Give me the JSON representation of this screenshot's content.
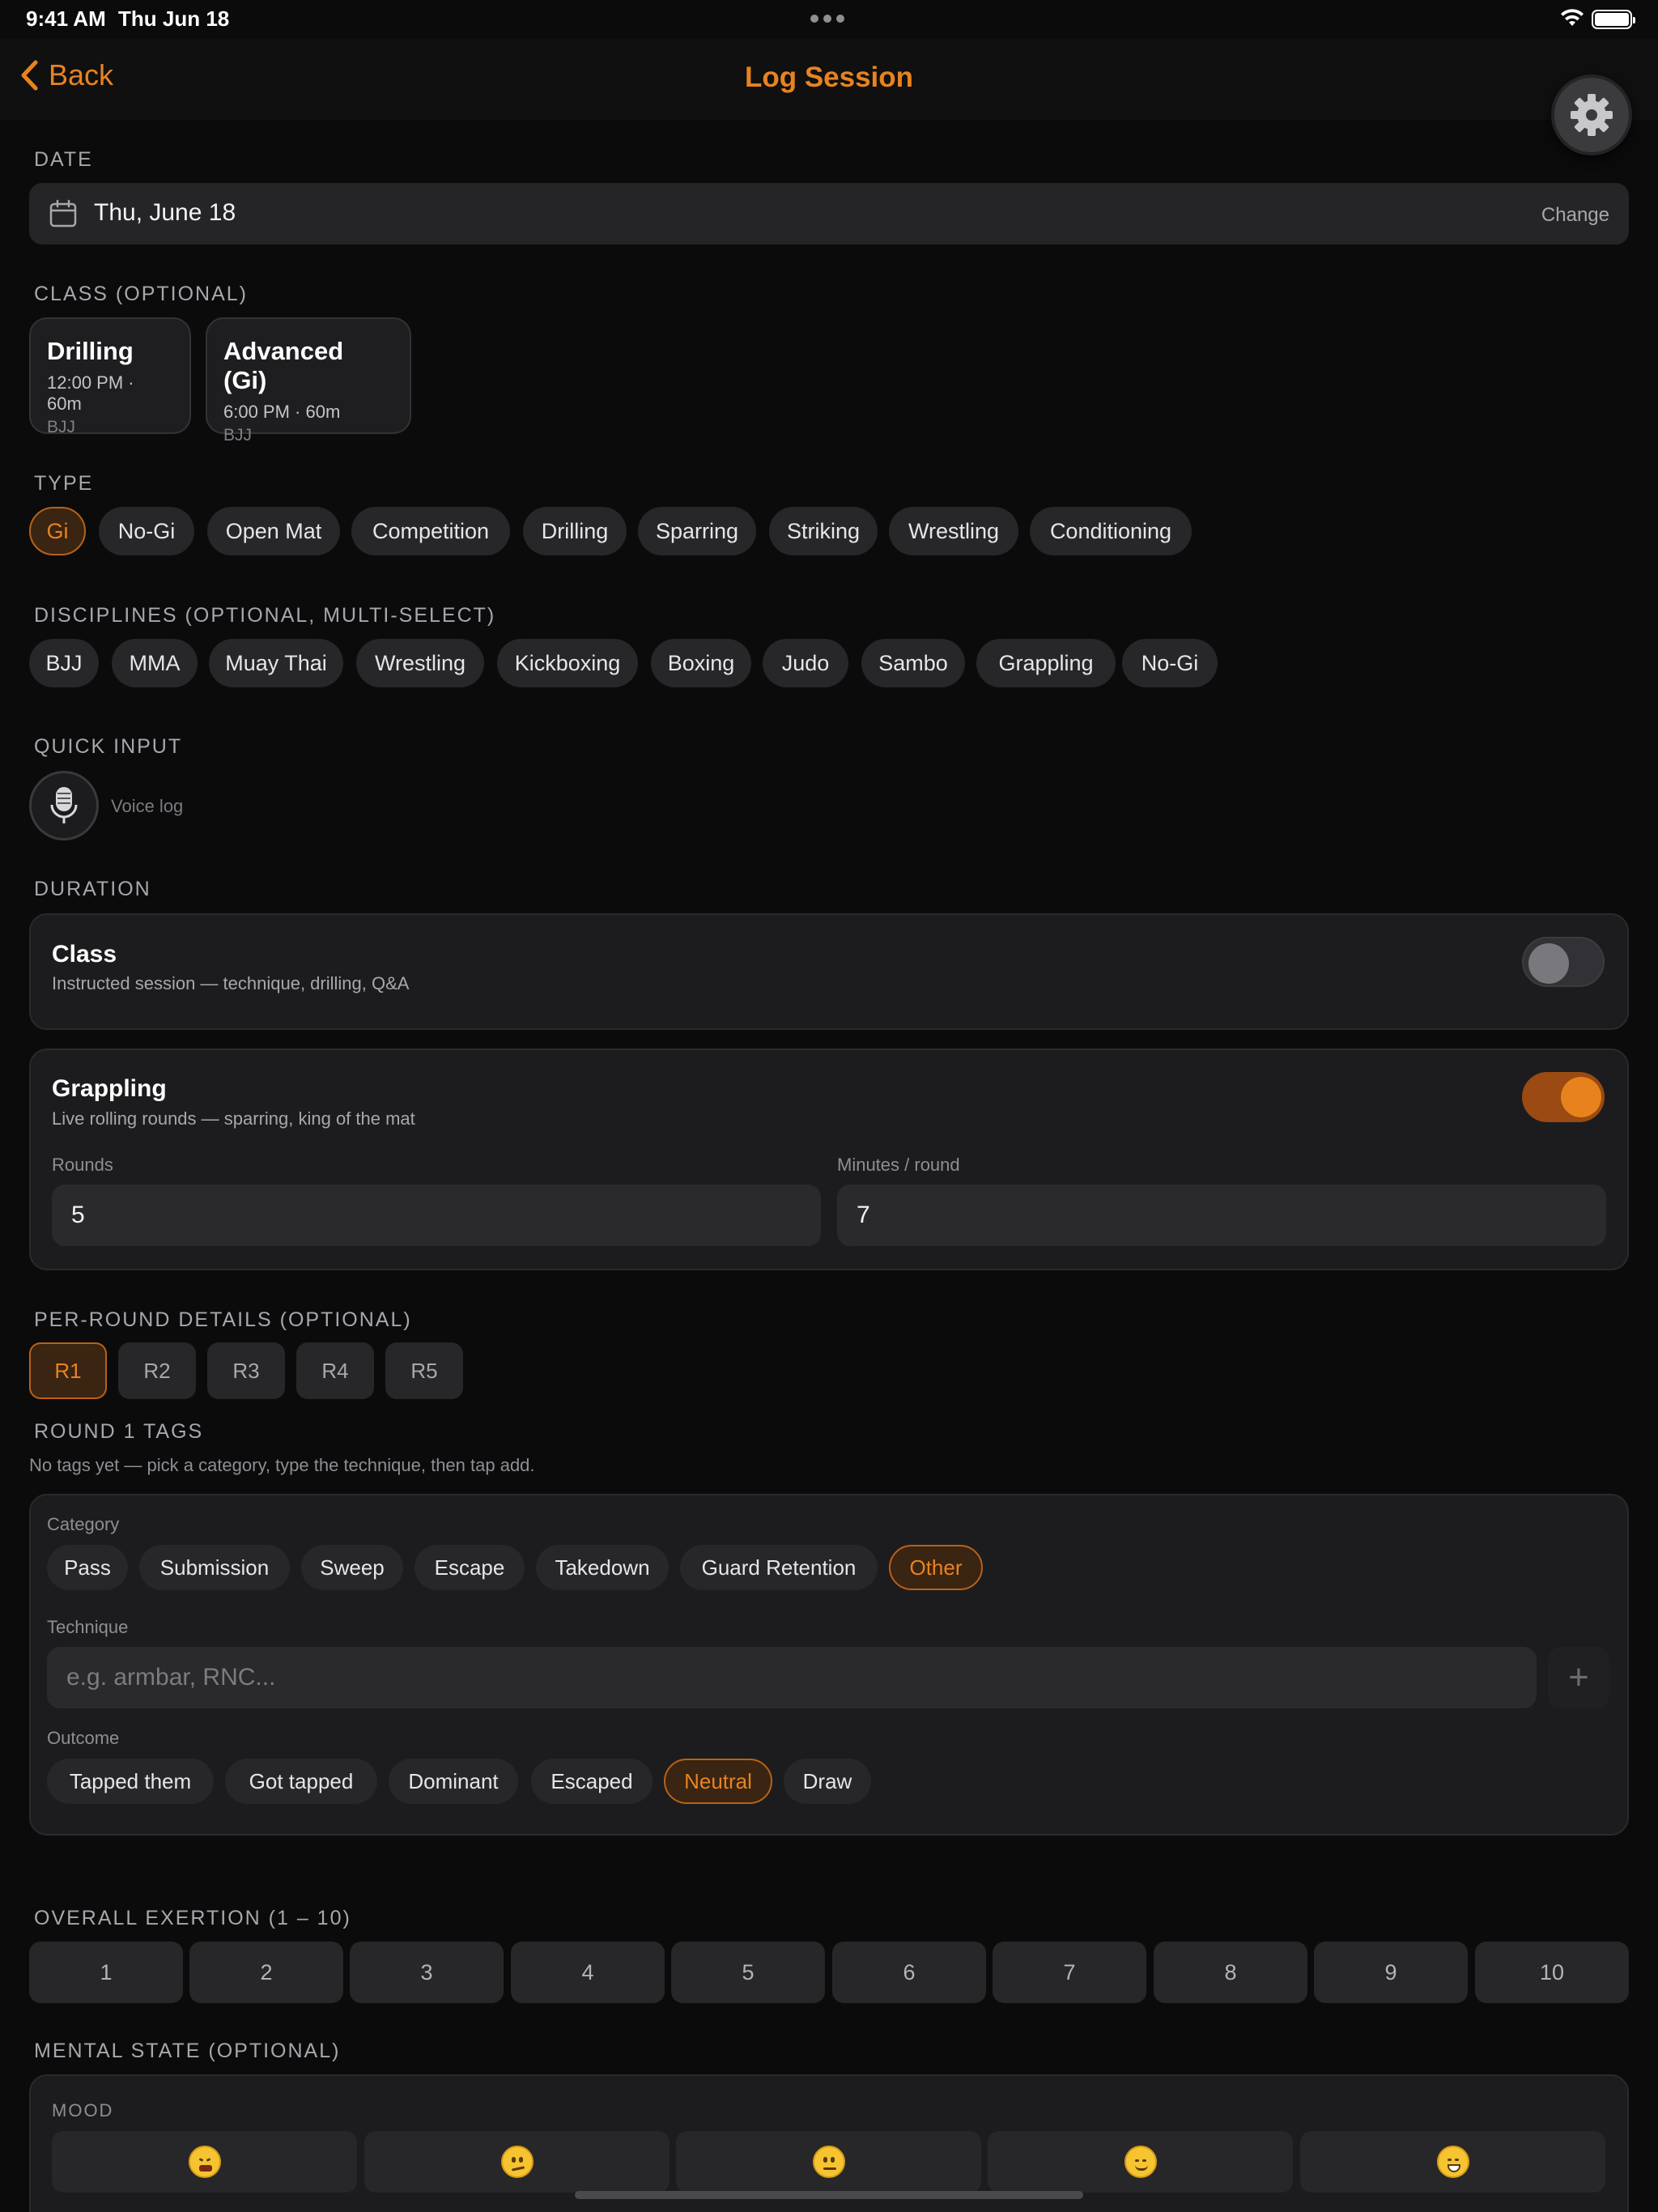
{
  "status": {
    "time": "9:41 AM",
    "date": "Thu Jun 18"
  },
  "nav": {
    "back": "Back",
    "title": "Log Session"
  },
  "date": {
    "label": "DATE",
    "value": "Thu, June 18",
    "change": "Change"
  },
  "class": {
    "label": "CLASS (OPTIONAL)",
    "items": [
      {
        "title": "Drilling",
        "time": "12:00 PM · 60m",
        "discipline": "BJJ"
      },
      {
        "title": "Advanced (Gi)",
        "time": "6:00 PM · 60m",
        "discipline": "BJJ"
      }
    ]
  },
  "type": {
    "label": "TYPE",
    "selected": "Gi",
    "items": [
      "Gi",
      "No-Gi",
      "Open Mat",
      "Competition",
      "Drilling",
      "Sparring",
      "Striking",
      "Wrestling",
      "Conditioning"
    ]
  },
  "disciplines": {
    "label": "DISCIPLINES (OPTIONAL, MULTI-SELECT)",
    "items": [
      "BJJ",
      "MMA",
      "Muay Thai",
      "Wrestling",
      "Kickboxing",
      "Boxing",
      "Judo",
      "Sambo",
      "Grappling",
      "No-Gi"
    ]
  },
  "quick_input": {
    "label": "QUICK INPUT",
    "voice": "Voice log"
  },
  "duration": {
    "label": "DURATION",
    "class": {
      "title": "Class",
      "subtitle": "Instructed session — technique, drilling, Q&A",
      "enabled": false
    },
    "grappling": {
      "title": "Grappling",
      "subtitle": "Live rolling rounds — sparring, king of the mat",
      "enabled": true,
      "rounds_label": "Rounds",
      "rounds": "5",
      "minutes_label": "Minutes / round",
      "minutes": "7"
    }
  },
  "per_round": {
    "label": "PER-ROUND DETAILS (OPTIONAL)",
    "rounds": [
      "R1",
      "R2",
      "R3",
      "R4",
      "R5"
    ],
    "selected": "R1"
  },
  "round_tags": {
    "label": "ROUND 1 TAGS",
    "hint": "No tags yet — pick a category, type the technique, then tap add.",
    "category_label": "Category",
    "categories": [
      "Pass",
      "Submission",
      "Sweep",
      "Escape",
      "Takedown",
      "Guard Retention",
      "Other"
    ],
    "category_selected": "Other",
    "technique_label": "Technique",
    "technique_placeholder": "e.g. armbar, RNC...",
    "add": "+",
    "outcome_label": "Outcome",
    "outcomes": [
      "Tapped them",
      "Got tapped",
      "Dominant",
      "Escaped",
      "Neutral",
      "Draw"
    ],
    "outcome_selected": "Neutral"
  },
  "exertion": {
    "label": "OVERALL EXERTION (1 – 10)",
    "values": [
      "1",
      "2",
      "3",
      "4",
      "5",
      "6",
      "7",
      "8",
      "9",
      "10"
    ]
  },
  "mental": {
    "label": "MENTAL STATE (OPTIONAL)",
    "mood_label": "MOOD",
    "moods": [
      "tired-face",
      "confused-face",
      "neutral-face",
      "smiling-face",
      "grinning-face"
    ]
  },
  "colors": {
    "accent": "#e8831f",
    "background": "#0b0b0c",
    "card": "#1c1c1e"
  }
}
